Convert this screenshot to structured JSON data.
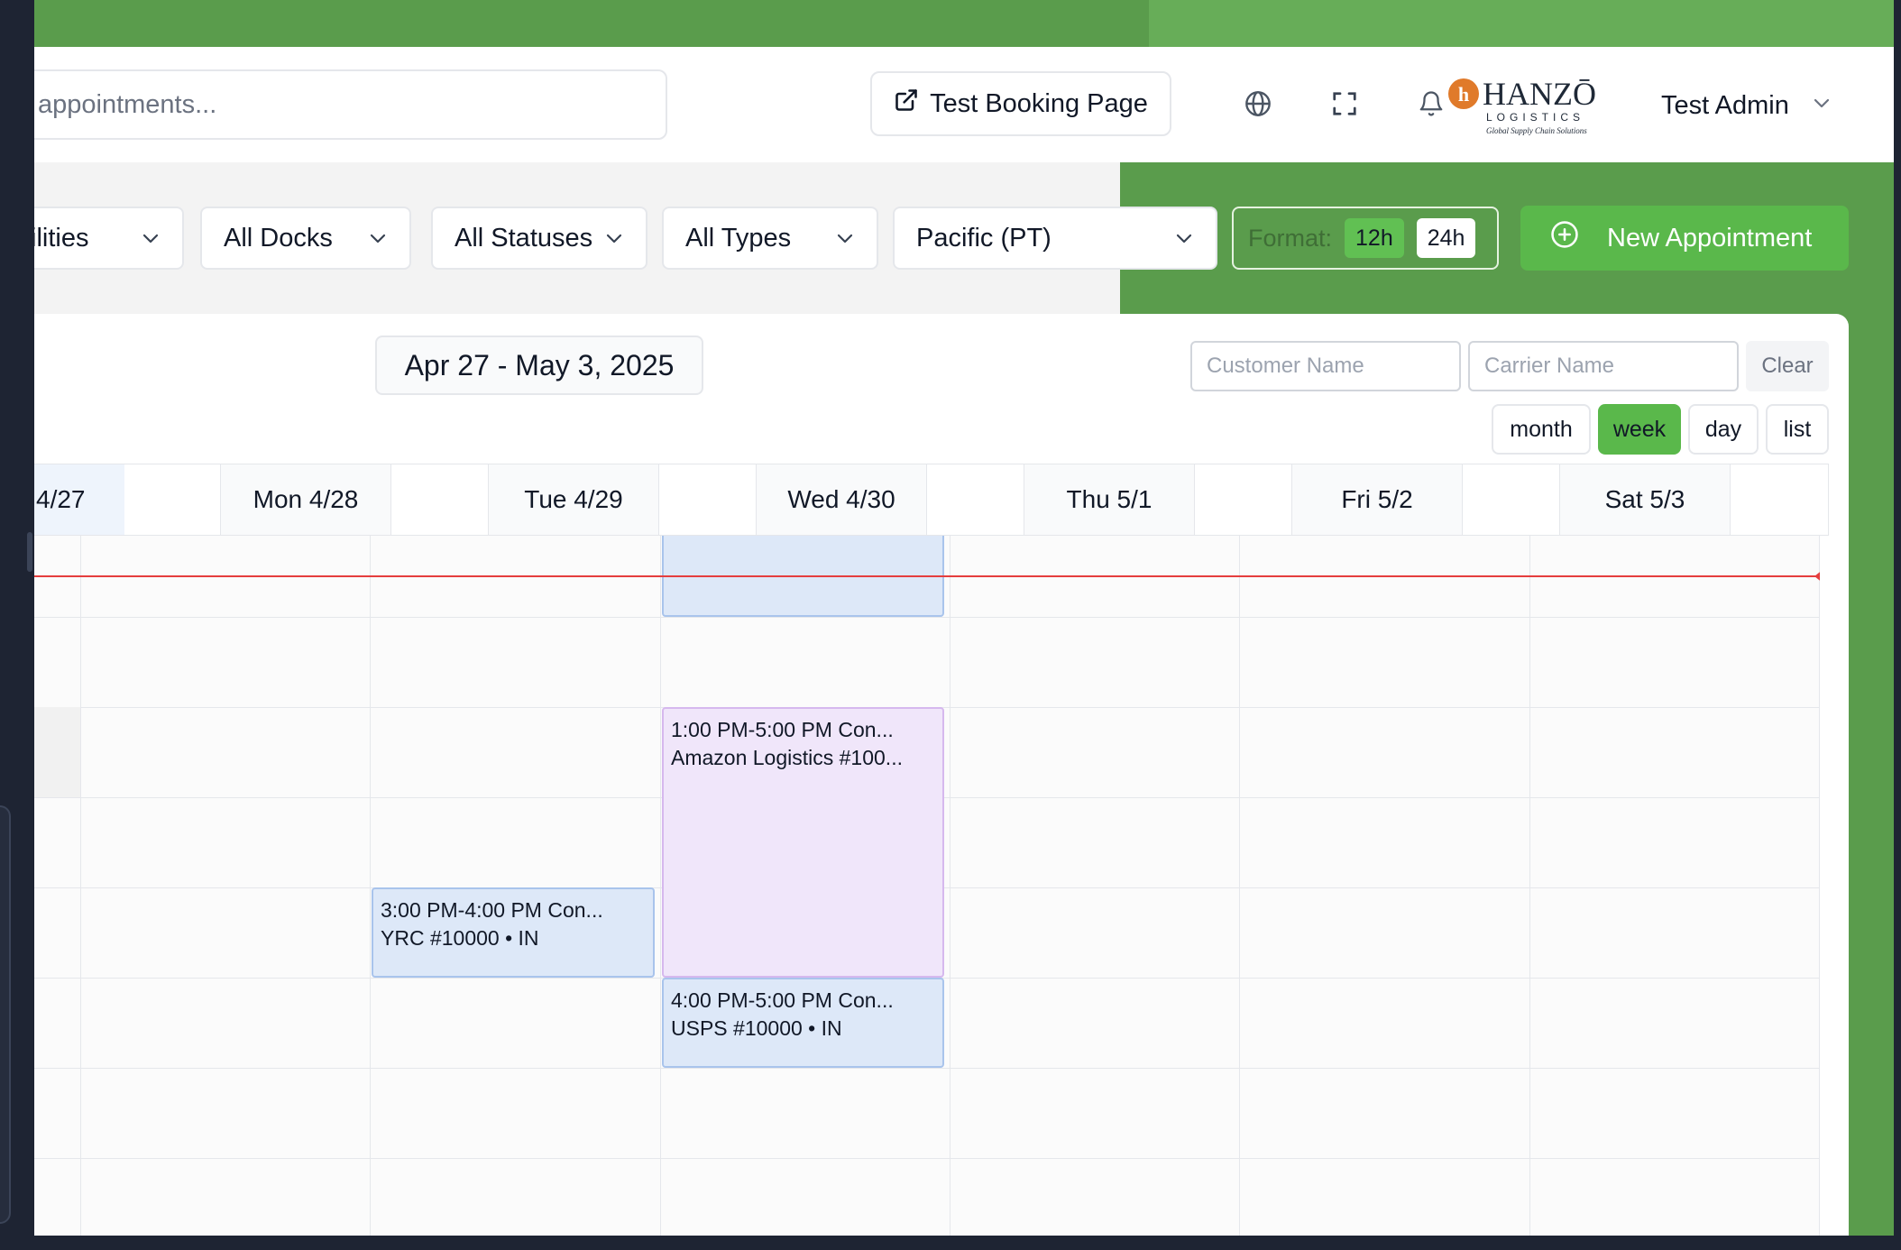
{
  "header": {
    "search_placeholder": "appointments...",
    "booking_button_label": "Test Booking Page",
    "user_name": "Test Admin"
  },
  "logo": {
    "brand": "HANZŌ",
    "sub": "LOGISTICS",
    "tagline": "Global Supply Chain Solutions"
  },
  "filters": {
    "facilities": "ilities",
    "docks": "All Docks",
    "statuses": "All Statuses",
    "types": "All Types",
    "timezone": "Pacific (PT)"
  },
  "format": {
    "label": "Format:",
    "options": [
      "12h",
      "24h"
    ],
    "selected": "12h"
  },
  "new_appointment_label": "New Appointment",
  "calendar": {
    "date_range": "Apr 27 - May 3, 2025",
    "customer_placeholder": "Customer Name",
    "carrier_placeholder": "Carrier Name",
    "clear_label": "Clear",
    "views": [
      "month",
      "week",
      "day",
      "list"
    ],
    "active_view": "week",
    "days": [
      "4/27",
      "Mon 4/28",
      "Tue 4/29",
      "Wed 4/30",
      "Thu 5/1",
      "Fri 5/2",
      "Sat 5/3"
    ],
    "events": [
      {
        "time": "",
        "details": ""
      },
      {
        "time": "1:00 PM-5:00 PM Con...",
        "details": "Amazon Logistics #100..."
      },
      {
        "time": "3:00 PM-4:00 PM Con...",
        "details": "YRC #10000 • IN"
      },
      {
        "time": "4:00 PM-5:00 PM Con...",
        "details": "USPS #10000 • IN"
      }
    ]
  },
  "colors": {
    "brand_green": "#5a9c4c",
    "action_green": "#5ab84b",
    "event_blue": "#dde8f8",
    "event_purple": "#f0e6fa",
    "now_line": "#e53e3e"
  }
}
